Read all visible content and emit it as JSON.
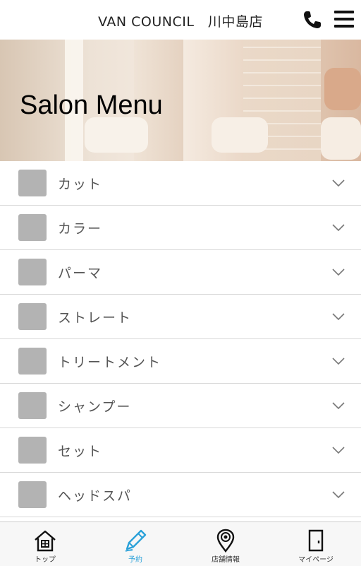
{
  "header": {
    "title": "VAN COUNCIL　川中島店"
  },
  "icons": {
    "phone": "phone-icon",
    "menu": "hamburger-menu-icon"
  },
  "hero": {
    "title": "Salon Menu"
  },
  "menu": {
    "items": [
      {
        "label": "カット"
      },
      {
        "label": "カラー"
      },
      {
        "label": "パーマ"
      },
      {
        "label": "ストレート"
      },
      {
        "label": "トリートメント"
      },
      {
        "label": "シャンプー"
      },
      {
        "label": "セット"
      },
      {
        "label": "ヘッドスパ"
      }
    ]
  },
  "tabbar": {
    "tabs": [
      {
        "label": "トップ",
        "icon": "home-icon"
      },
      {
        "label": "予約",
        "icon": "pencil-icon",
        "active": true
      },
      {
        "label": "店舗情報",
        "icon": "map-pin-icon"
      },
      {
        "label": "マイページ",
        "icon": "door-icon"
      }
    ]
  },
  "colors": {
    "accent": "#2aa1d9",
    "thumb": "#b3b3b3"
  }
}
